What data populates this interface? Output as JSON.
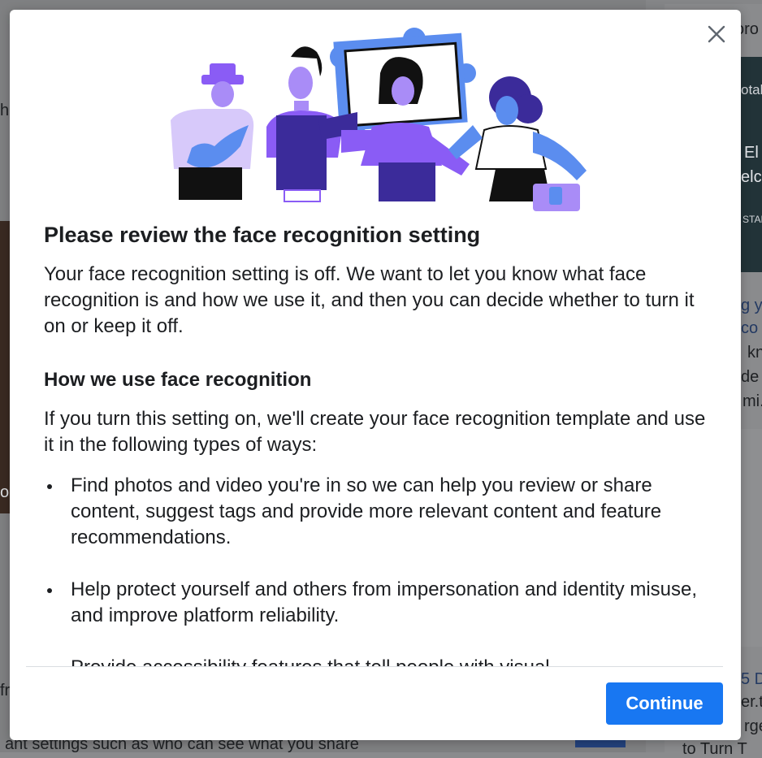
{
  "modal": {
    "title": "Please review the face recognition setting",
    "intro": "Your face recognition setting is off. We want to let you know what face recognition is and how we use it, and then you can decide whether to turn it on or keep it off.",
    "subheading": "How we use face recognition",
    "body": "If you turn this setting on, we'll create your face recognition template and use it in the following types of ways:",
    "bullets": [
      "Find photos and video you're in so we can help you review or share content, suggest tags and provide more relevant content and feature recommendations.",
      "Help protect yourself and others from impersonation and identity misuse, and improve platform reliability.",
      "Provide accessibility features that tell people with visual"
    ],
    "continue_label": "Continue",
    "close_icon": "close-icon",
    "illustration": "group-of-people-holding-picture-frame"
  },
  "background": {
    "fragments": [
      "oro",
      "otal",
      "El",
      "elc",
      "STAR",
      "g y",
      "co",
      "kn",
      "de",
      "mi.",
      "5 D",
      "er.t",
      "rge",
      "to Turn T",
      "fr",
      "ant settings such as who can see what you share",
      "he",
      "o"
    ]
  },
  "colors": {
    "primary": "#1877f2",
    "illustration_blue": "#5b8def",
    "illustration_purple": "#8a5cf5",
    "illustration_lavender": "#d7c9fa",
    "text": "#1c1e21"
  }
}
